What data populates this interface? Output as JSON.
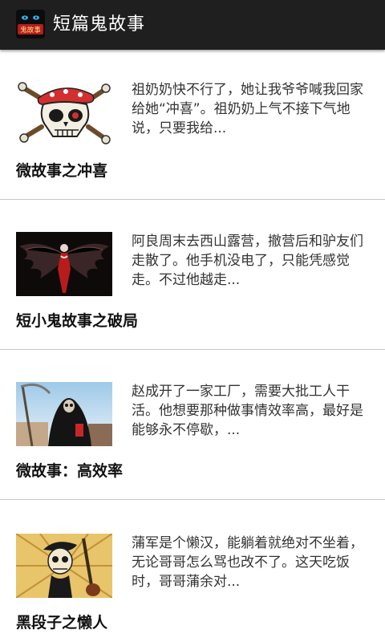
{
  "app": {
    "title": "短篇鬼故事",
    "icon_name": "ghost-story-app-icon",
    "icon_text": "鬼故事"
  },
  "colors": {
    "action_bar": "#1f1f1f",
    "title_text": "#ffffff",
    "divider": "#c8c8c8",
    "summary_text": "#333333",
    "story_title_text": "#111111"
  },
  "stories": [
    {
      "thumbnail": "skull-and-crossbones-thumbnail",
      "summary": "祖奶奶快不行了，她让我爷爷喊我回家给她“冲喜”。祖奶奶上气不接下气地说，只要我给...",
      "title": "微故事之冲喜"
    },
    {
      "thumbnail": "dark-winged-angel-thumbnail",
      "summary": "阿良周末去西山露营，撤营后和驴友们走散了。他手机没电了，只能凭感觉走。不过他越走...",
      "title": "短小鬼故事之破局"
    },
    {
      "thumbnail": "grim-reaper-thumbnail",
      "summary": "赵成开了一家工厂，需要大批工人干活。他想要那种做事情效率高，最好是能够永不停歇，...",
      "title": "微故事：高效率"
    },
    {
      "thumbnail": "skeleton-with-guitar-thumbnail",
      "summary": "蒲军是个懒汉，能躺着就绝对不坐着，无论哥哥怎么骂也改不了。这天吃饭时，哥哥蒲余对...",
      "title": "黑段子之懒人"
    }
  ]
}
